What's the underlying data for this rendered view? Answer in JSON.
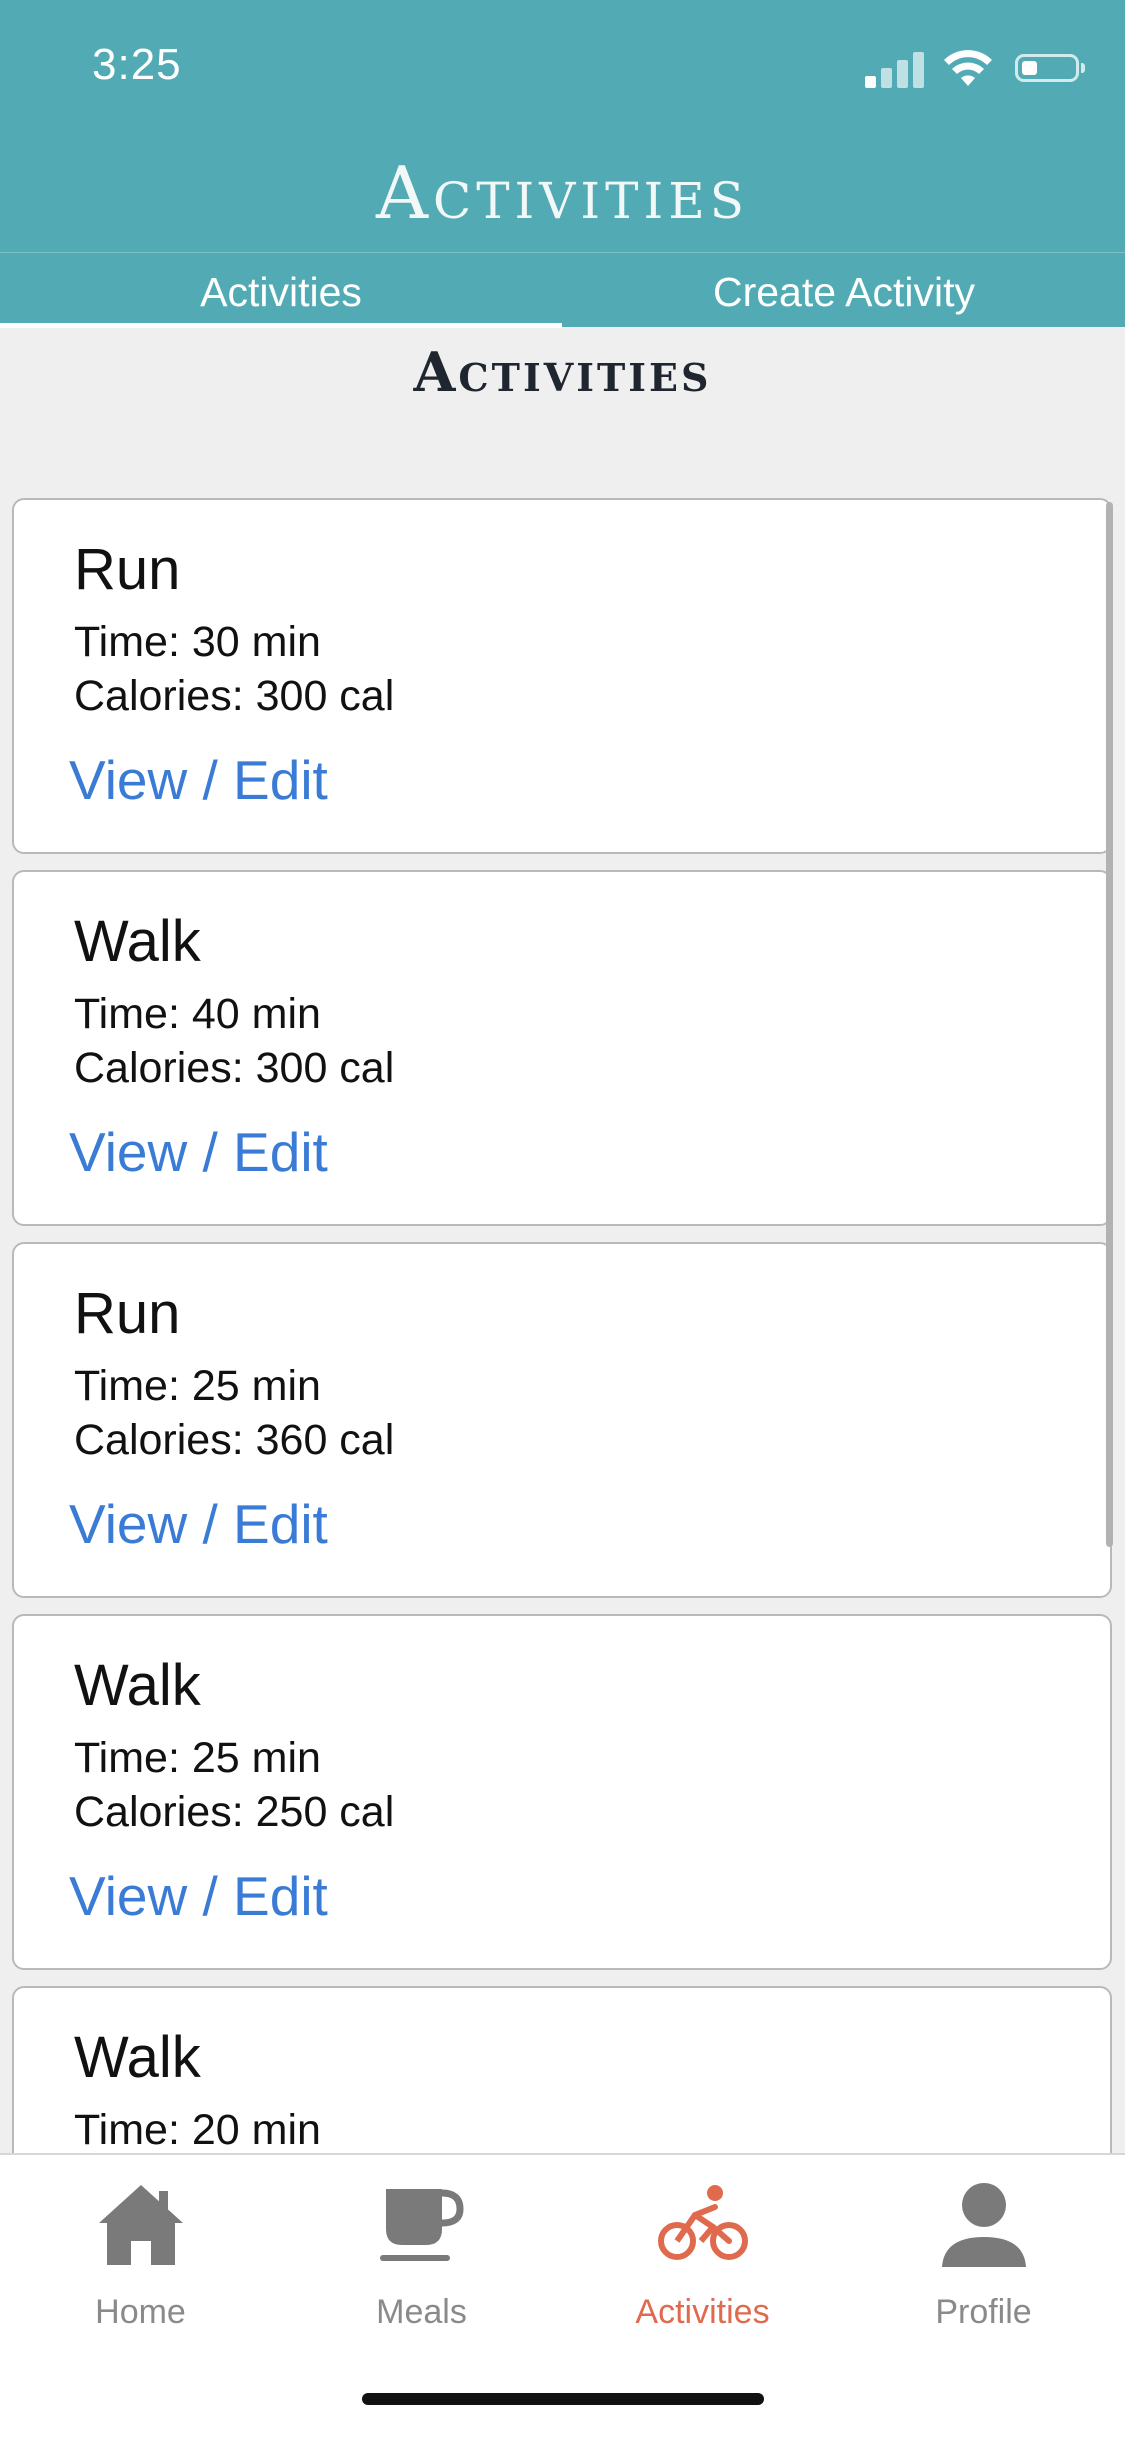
{
  "status": {
    "time": "3:25"
  },
  "header": {
    "title": "Activities"
  },
  "tabs": [
    {
      "label": "Activities",
      "selected": true
    },
    {
      "label": "Create Activity",
      "selected": false
    }
  ],
  "section": {
    "title": "Activities"
  },
  "activities": [
    {
      "name": "Run",
      "time": "Time: 30 min",
      "calories": "Calories: 300 cal",
      "link": "View / Edit"
    },
    {
      "name": "Walk",
      "time": "Time: 40 min",
      "calories": "Calories: 300 cal",
      "link": "View / Edit"
    },
    {
      "name": "Run",
      "time": "Time: 25 min",
      "calories": "Calories: 360 cal",
      "link": "View / Edit"
    },
    {
      "name": "Walk",
      "time": "Time: 25 min",
      "calories": "Calories: 250 cal",
      "link": "View / Edit"
    },
    {
      "name": "Walk",
      "time": "Time: 20 min",
      "calories": "",
      "link": ""
    }
  ],
  "nav": [
    {
      "label": "Home",
      "icon": "home-icon"
    },
    {
      "label": "Meals",
      "icon": "coffee-cup-icon"
    },
    {
      "label": "Activities",
      "icon": "bicycle-icon",
      "active": true
    },
    {
      "label": "Profile",
      "icon": "person-icon"
    }
  ],
  "colors": {
    "header": "#52abb4",
    "link": "#3a7bd5",
    "active_nav": "#e06a4e",
    "inactive_nav": "#8a8a8a"
  }
}
